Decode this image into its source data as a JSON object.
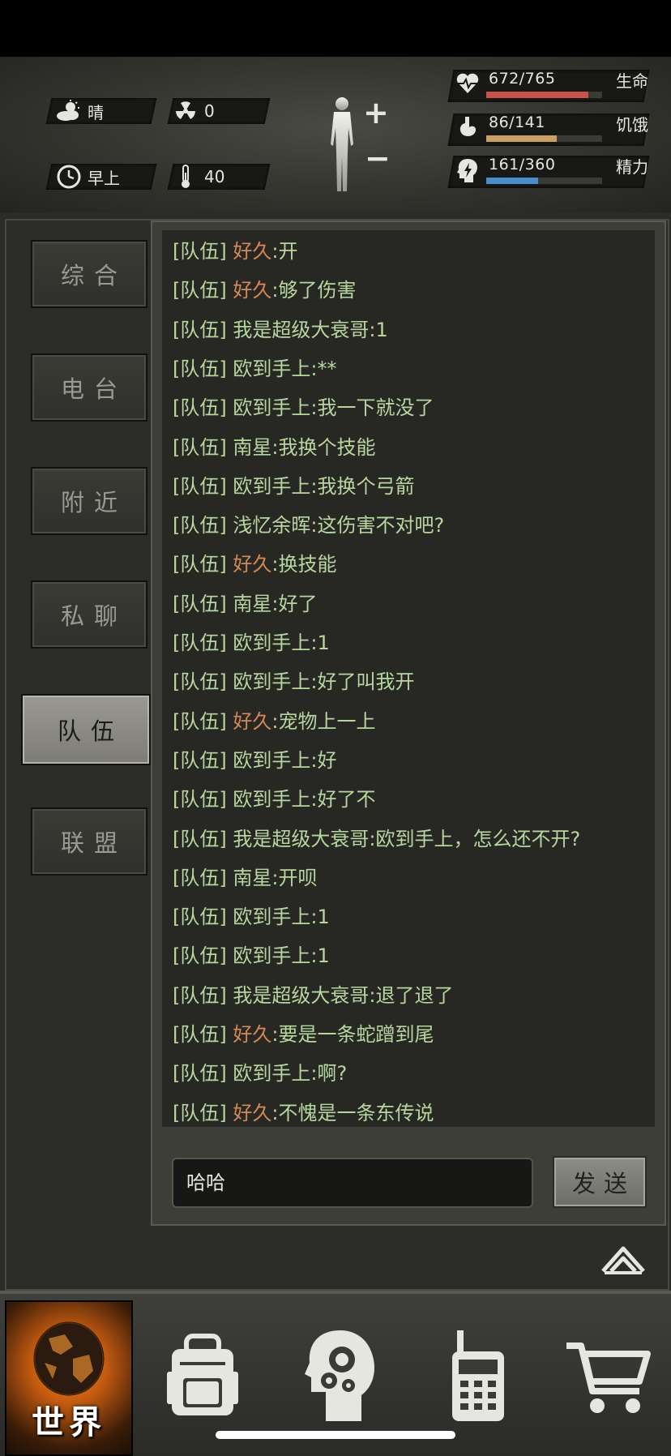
{
  "status": {
    "weather": "晴",
    "radiation": "0",
    "time_of_day": "早上",
    "temperature": "40",
    "health": {
      "value": "672/765",
      "label": "生命",
      "fraction": 0.878,
      "color": "#c9534a"
    },
    "hunger": {
      "value": "86/141",
      "label": "饥饿",
      "fraction": 0.61,
      "color": "#c9a062"
    },
    "energy": {
      "value": "161/360",
      "label": "精力",
      "fraction": 0.447,
      "color": "#4a8cc9"
    }
  },
  "tabs": [
    {
      "label": "综合",
      "active": false
    },
    {
      "label": "电台",
      "active": false
    },
    {
      "label": "附近",
      "active": false
    },
    {
      "label": "私聊",
      "active": false
    },
    {
      "label": "队伍",
      "active": true
    },
    {
      "label": "联盟",
      "active": false
    }
  ],
  "chat": {
    "messages": [
      {
        "channel": "[队伍]",
        "name": "好久",
        "highlight": true,
        "text": "开"
      },
      {
        "channel": "[队伍]",
        "name": "好久",
        "highlight": true,
        "text": "够了伤害"
      },
      {
        "channel": "[队伍]",
        "name": "我是超级大衰哥",
        "highlight": false,
        "text": "1"
      },
      {
        "channel": "[队伍]",
        "name": "欧到手上",
        "highlight": false,
        "text": "**"
      },
      {
        "channel": "[队伍]",
        "name": "欧到手上",
        "highlight": false,
        "text": "我一下就没了"
      },
      {
        "channel": "[队伍]",
        "name": "南星",
        "highlight": false,
        "text": "我换个技能"
      },
      {
        "channel": "[队伍]",
        "name": "欧到手上",
        "highlight": false,
        "text": "我换个弓箭"
      },
      {
        "channel": "[队伍]",
        "name": "浅忆余晖",
        "highlight": false,
        "text": "这伤害不对吧?"
      },
      {
        "channel": "[队伍]",
        "name": "好久",
        "highlight": true,
        "text": "换技能"
      },
      {
        "channel": "[队伍]",
        "name": "南星",
        "highlight": false,
        "text": "好了"
      },
      {
        "channel": "[队伍]",
        "name": "欧到手上",
        "highlight": false,
        "text": "1"
      },
      {
        "channel": "[队伍]",
        "name": "欧到手上",
        "highlight": false,
        "text": "好了叫我开"
      },
      {
        "channel": "[队伍]",
        "name": "好久",
        "highlight": true,
        "text": "宠物上一上"
      },
      {
        "channel": "[队伍]",
        "name": "欧到手上",
        "highlight": false,
        "text": "好"
      },
      {
        "channel": "[队伍]",
        "name": "欧到手上",
        "highlight": false,
        "text": "好了不"
      },
      {
        "channel": "[队伍]",
        "name": "我是超级大衰哥",
        "highlight": false,
        "text": "欧到手上，怎么还不开?"
      },
      {
        "channel": "[队伍]",
        "name": "南星",
        "highlight": false,
        "text": "开呗"
      },
      {
        "channel": "[队伍]",
        "name": "欧到手上",
        "highlight": false,
        "text": "1"
      },
      {
        "channel": "[队伍]",
        "name": "欧到手上",
        "highlight": false,
        "text": "1"
      },
      {
        "channel": "[队伍]",
        "name": "我是超级大衰哥",
        "highlight": false,
        "text": "退了退了"
      },
      {
        "channel": "[队伍]",
        "name": "好久",
        "highlight": true,
        "text": "要是一条蛇蹭到尾"
      },
      {
        "channel": "[队伍]",
        "name": "欧到手上",
        "highlight": false,
        "text": "啊?"
      },
      {
        "channel": "[队伍]",
        "name": "好久",
        "highlight": true,
        "text": "不愧是一条东传说"
      }
    ],
    "input_value": "哈哈",
    "send_label": "发送"
  },
  "nav": {
    "world_label": "世界",
    "items": [
      "world-icon",
      "backpack-icon",
      "skills-head-icon",
      "radio-icon",
      "shop-cart-icon"
    ]
  }
}
